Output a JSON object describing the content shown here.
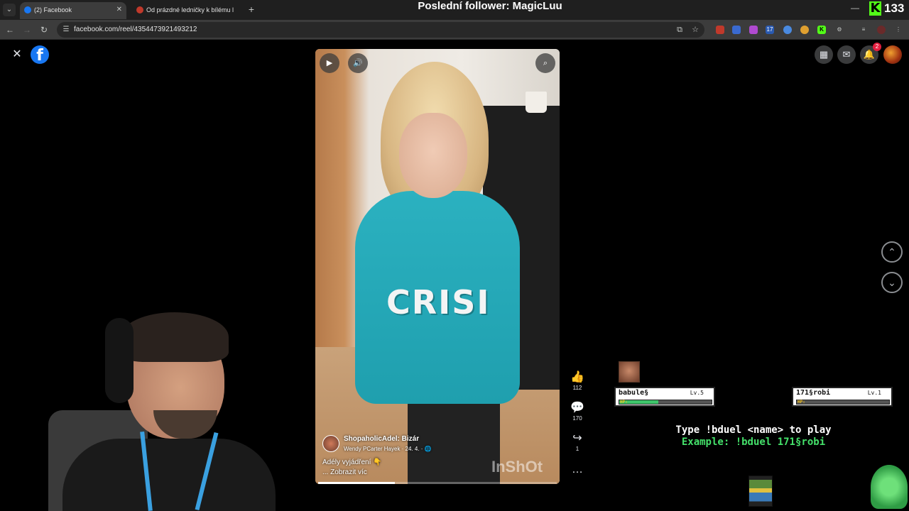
{
  "browser": {
    "tabs": [
      {
        "title": "(2) Facebook",
        "active": true,
        "icon": "facebook-icon"
      },
      {
        "title": "Od prázdné ledničky k bílému l",
        "active": false,
        "icon": "page-favicon"
      }
    ],
    "url": "facebook.com/reel/4354473921493212",
    "extension_badge": "17"
  },
  "stream": {
    "title": "Poslední follower: MagicLuu",
    "kick_viewers": "133"
  },
  "facebook": {
    "notification_count": "2",
    "reel": {
      "page_name": "ShopaholicAdel: Bizár",
      "author": "Wendy PCarter Hayek",
      "date": "· 24. 4. ·",
      "caption": "Adély vyjádření 👇",
      "see_more": "... Zobrazit víc",
      "watermark": "InShOt",
      "hoodie_text": "CRISI",
      "progress": 0.32
    },
    "reactions": {
      "likes": "112",
      "comments": "170",
      "shares": "1"
    }
  },
  "duel": {
    "player1": {
      "name": "babule§",
      "level": "Lv.5",
      "hp_label": "HP:",
      "hp": 0.42
    },
    "player2": {
      "name": "171§robi",
      "level": "Lv.1",
      "hp_label": "HP:",
      "hp": 0.0
    },
    "hint": "Type !bduel <name> to play",
    "example": "Example: !bduel 171§robi"
  },
  "colors": {
    "facebook_blue": "#1877f2",
    "kick_green": "#53fc18",
    "hp_green": "#3ec46a",
    "hint_green": "#44e06a"
  }
}
